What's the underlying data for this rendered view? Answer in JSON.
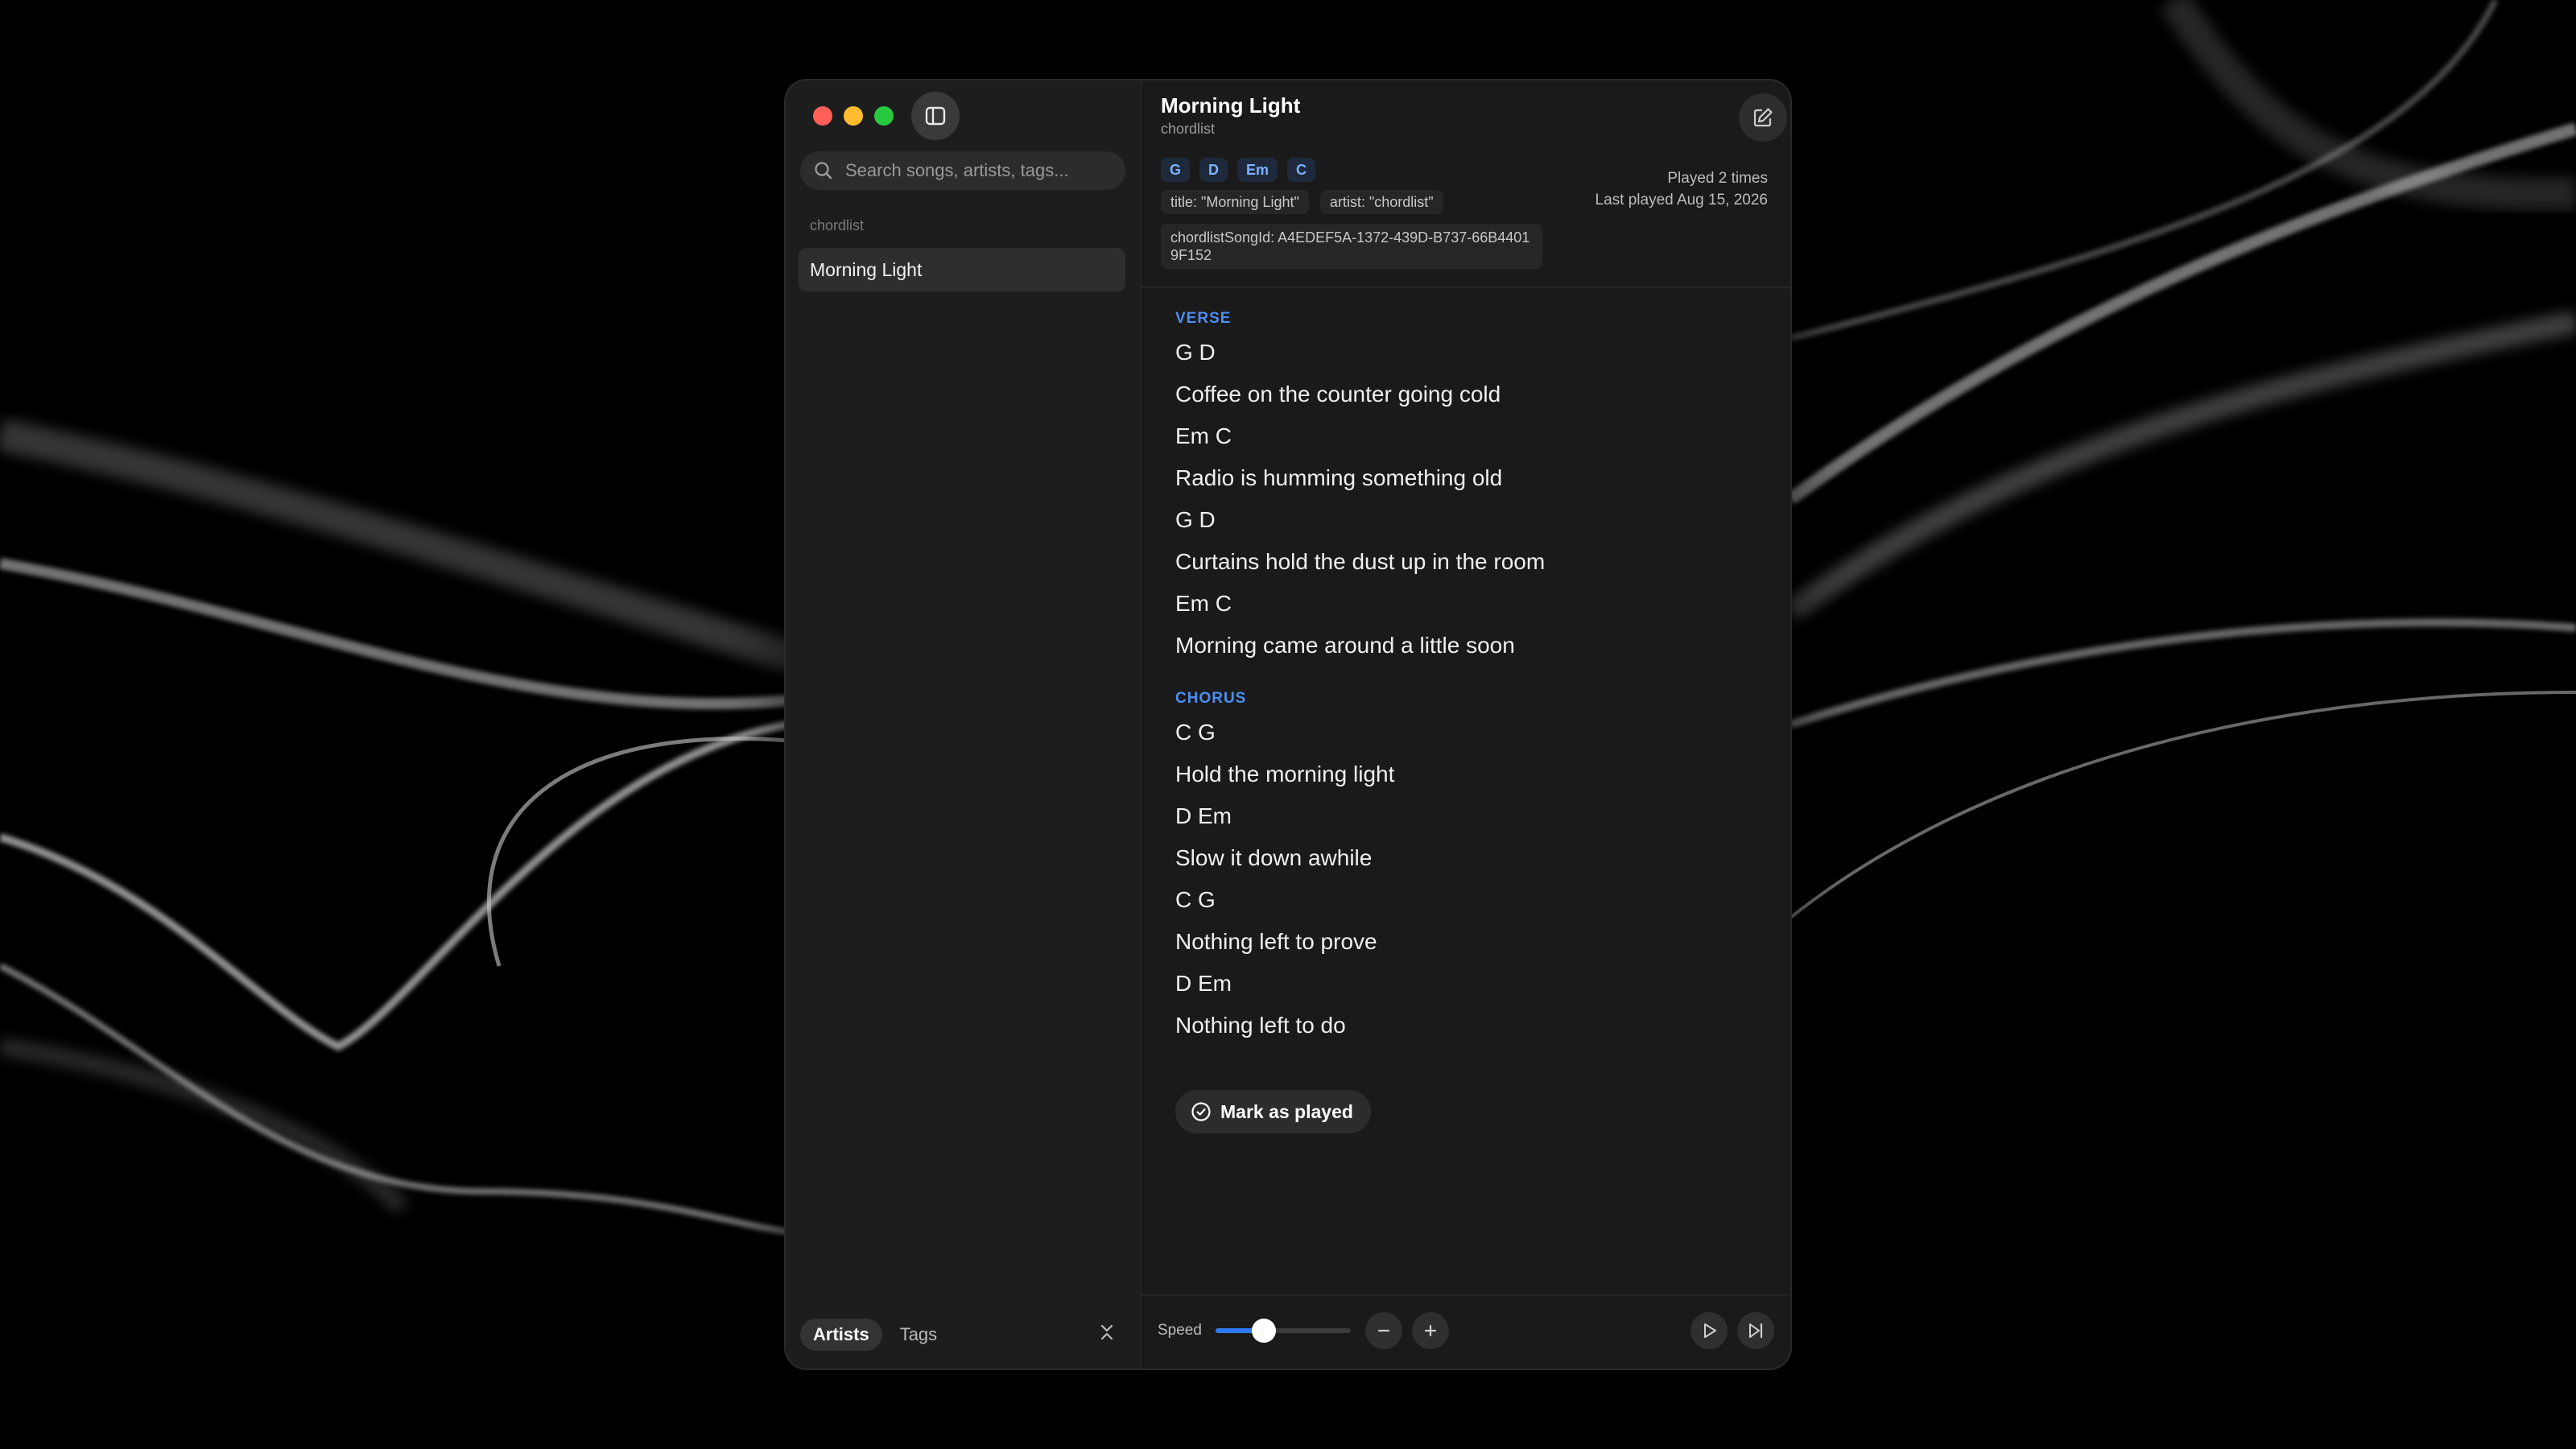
{
  "sidebar": {
    "search_placeholder": "Search songs, artists, tags...",
    "section_label": "chordlist",
    "songs": [
      {
        "title": "Morning Light",
        "selected": true
      }
    ],
    "tabs": [
      {
        "label": "Artists",
        "active": true
      },
      {
        "label": "Tags",
        "active": false
      }
    ]
  },
  "song": {
    "title": "Morning Light",
    "artist": "chordlist",
    "chords": [
      "G",
      "D",
      "Em",
      "C"
    ],
    "meta_tags": [
      "title: \"Morning Light\"",
      "artist: \"chordlist\""
    ],
    "id_tag": "chordlistSongId: A4EDEF5A-1372-439D-B737-66B44019F152",
    "played_count": "Played 2 times",
    "last_played": "Last played Aug 15, 2026"
  },
  "sections": [
    {
      "heading": "VERSE",
      "lines": [
        "G D",
        "Coffee on the counter going cold",
        "Em C",
        "Radio is humming something old",
        "G D",
        "Curtains hold the dust up in the room",
        "Em C",
        "Morning came around a little soon"
      ]
    },
    {
      "heading": "CHORUS",
      "lines": [
        "C G",
        "Hold the morning light",
        "D Em",
        "Slow it down awhile",
        "C G",
        "Nothing left to prove",
        "D Em",
        "Nothing left to do"
      ]
    }
  ],
  "actions": {
    "mark_played": "Mark as played"
  },
  "playback": {
    "speed_label": "Speed",
    "speed_value": 0.36
  },
  "colors": {
    "accent": "#2d7cf6",
    "chord_chip_text": "#7fb0ff",
    "section_heading": "#4b8ef5"
  },
  "icons": [
    "sidebar-toggle-icon",
    "search-icon",
    "edit-icon",
    "check-circle-icon",
    "collapse-icon",
    "minus-icon",
    "plus-icon",
    "play-icon",
    "skip-forward-icon"
  ]
}
